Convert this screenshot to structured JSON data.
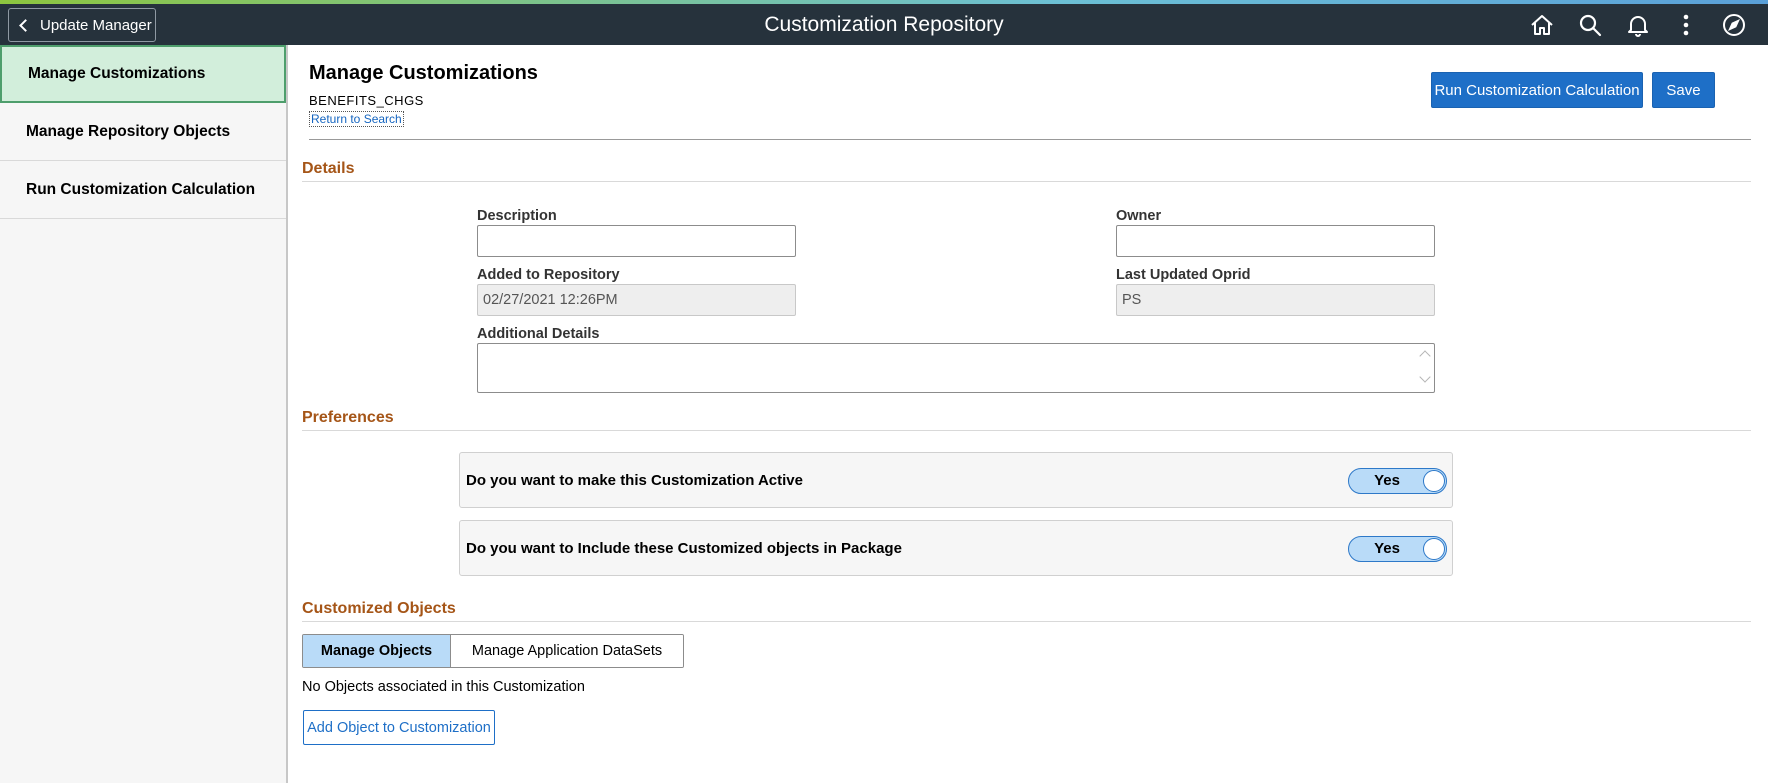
{
  "banner": {
    "back_label": "Update Manager",
    "title": "Customization Repository",
    "icons": [
      "home-icon",
      "search-icon",
      "bell-icon",
      "more-vertical-icon",
      "navbar-compass-icon"
    ]
  },
  "sidebar": {
    "items": [
      {
        "label": "Manage Customizations",
        "active": true
      },
      {
        "label": "Manage Repository Objects",
        "active": false
      },
      {
        "label": "Run Customization Calculation",
        "active": false
      }
    ]
  },
  "header": {
    "title": "Manage Customizations",
    "subtitle": "BENEFITS_CHGS",
    "return_link": "Return to Search",
    "run_button": "Run Customization Calculation",
    "save_button": "Save"
  },
  "details": {
    "section_title": "Details",
    "description_label": "Description",
    "description_value": "",
    "owner_label": "Owner",
    "owner_value": "",
    "added_label": "Added to Repository",
    "added_value": "02/27/2021 12:26PM",
    "oprid_label": "Last Updated Oprid",
    "oprid_value": "PS",
    "additional_label": "Additional Details",
    "additional_value": ""
  },
  "preferences": {
    "section_title": "Preferences",
    "items": [
      {
        "label": "Do you want to make this Customization Active",
        "toggle": "Yes"
      },
      {
        "label": "Do you want to Include these Customized objects in Package",
        "toggle": "Yes"
      }
    ]
  },
  "customized_objects": {
    "section_title": "Customized Objects",
    "tabs": [
      {
        "label": "Manage Objects",
        "selected": true
      },
      {
        "label": "Manage Application DataSets",
        "selected": false
      }
    ],
    "empty_message": "No Objects associated in this Customization",
    "add_button": "Add Object to Customization"
  },
  "colors": {
    "banner_bg": "#26323c",
    "primary": "#1e6fc7",
    "section_title": "#a55517",
    "active_nav_bg": "#d2eedb",
    "toggle_bg": "#b9dbf8"
  }
}
